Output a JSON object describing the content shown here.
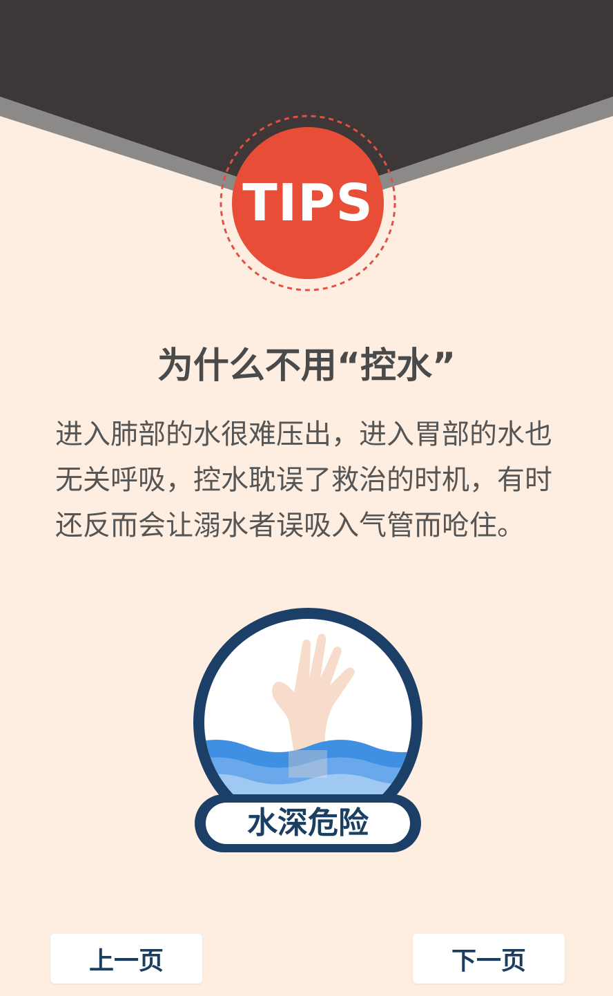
{
  "header": {
    "badge_text": "TIPS",
    "colors": {
      "dark_band": "#3d3837",
      "stripe": "#8c8a89",
      "badge_fill": "#e84e37",
      "badge_dash": "#e05044"
    }
  },
  "content": {
    "title": "为什么不用“控水”",
    "body": "进入肺部的水很难压出，进入胃部的水也无关呼吸，控水耽误了救治的时机，有时还反而会让溺水者误吸入气管而呛住。"
  },
  "illustration": {
    "label": "水深危险",
    "icon": "drowning-hand-icon",
    "colors": {
      "ring": "#1b3f66",
      "water_dark": "#3f8fe2",
      "water_light": "#9fc9f2",
      "hand": "#f7dccc"
    }
  },
  "navigation": {
    "prev_label": "上一页",
    "next_label": "下一页"
  },
  "page_background": "#fdeee1"
}
